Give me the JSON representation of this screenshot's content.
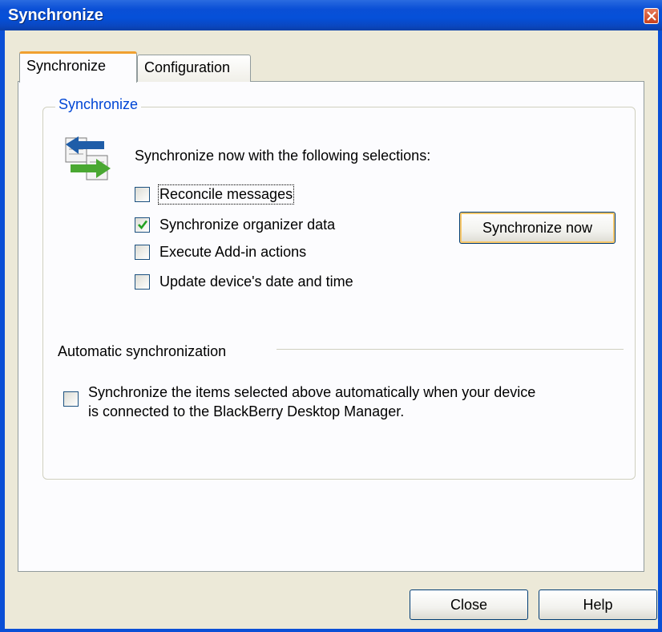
{
  "window": {
    "title": "Synchronize"
  },
  "tabs": [
    {
      "label": "Synchronize",
      "selected": true
    },
    {
      "label": "Configuration",
      "selected": false
    }
  ],
  "sync_group": {
    "title": "Synchronize",
    "icon": "sync-arrows-icon",
    "intro": "Synchronize now with the following selections:",
    "options": [
      {
        "label": "Reconcile messages",
        "checked": false
      },
      {
        "label": "Synchronize organizer data",
        "checked": true
      },
      {
        "label": "Execute Add-in actions",
        "checked": false
      },
      {
        "label": "Update device's date and time",
        "checked": false
      }
    ],
    "sync_button": "Synchronize now"
  },
  "auto": {
    "title": "Automatic synchronization",
    "line1": "Synchronize the items selected above automatically when your device",
    "line2": "is connected to the BlackBerry Desktop Manager.",
    "checked": false
  },
  "footer": {
    "close": "Close",
    "help": "Help"
  },
  "colors": {
    "titlebar": "#0a4fd6",
    "accent": "#0046d5",
    "check": "#21a121",
    "tab_highlight": "#f0a030"
  }
}
